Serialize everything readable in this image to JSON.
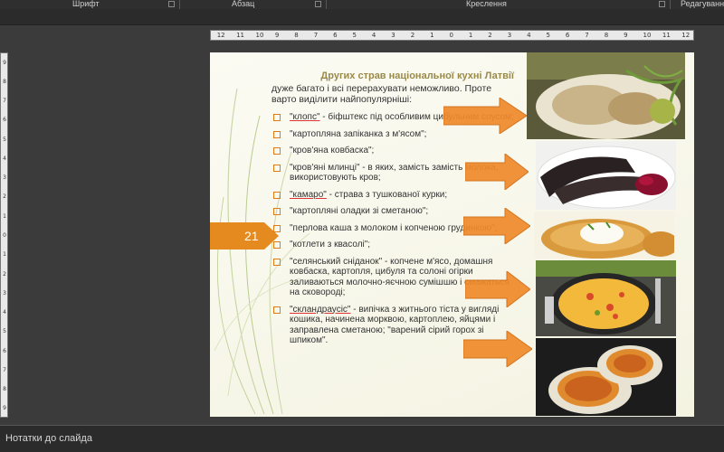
{
  "ribbon": {
    "groups": [
      "Шрифт",
      "Абзац",
      "Креслення",
      "Редагуванн"
    ]
  },
  "ruler": {
    "horizontal": [
      "12",
      "11",
      "10",
      "9",
      "8",
      "7",
      "6",
      "5",
      "4",
      "3",
      "2",
      "1",
      "0",
      "1",
      "2",
      "3",
      "4",
      "5",
      "6",
      "7",
      "8",
      "9",
      "10",
      "11",
      "12"
    ],
    "vertical": [
      "9",
      "8",
      "7",
      "6",
      "5",
      "4",
      "3",
      "2",
      "1",
      "0",
      "1",
      "2",
      "3",
      "4",
      "5",
      "6",
      "7",
      "8",
      "9"
    ]
  },
  "slide": {
    "title": "Других страв національної кухні Латвії",
    "intro": "дуже багато і всі перерахувати неможливо. Проте варто виділити найпопулярніші:",
    "page_number": "21",
    "items": [
      {
        "dish": "\"клопс\"",
        "rest": " - біфштекс під особливим цибульним соусом;"
      },
      {
        "dish": "",
        "rest": " \"картопляна запіканка з м'ясом\";"
      },
      {
        "dish": "",
        "rest": "\"кров'яна ковбаска\";"
      },
      {
        "dish": "",
        "rest": "\"кров'яні млинці\" - в яких, замість замість молока, використовують кров;"
      },
      {
        "dish": "\"камаро\"",
        "rest": " - страва з тушкованої курки;"
      },
      {
        "dish": "",
        "rest": "\"картопляні оладки зі сметаною\";"
      },
      {
        "dish": "",
        "rest": "\"перлова каша з молоком і копченою грудинкою\";"
      },
      {
        "dish": "",
        "rest": "\"котлети з квасолі\";"
      },
      {
        "dish": "",
        "rest": "\"селянський сніданок\" - копчене м'ясо, домашня ковбаска, картопля, цибуля та солоні огірки заливаються молочно-яєчною сумішшю і смажаться на сковороді;"
      },
      {
        "dish": "\"скландраусіс\"",
        "rest": " - випічка з житнього тіста у вигляді кошика, начинена морквою, картоплею, яйцями і заправлена сметаною; \"варений сірий горох зі шпиком\"."
      }
    ]
  },
  "notes": {
    "label": "Нотатки до слайда"
  },
  "colors": {
    "accent": "#e07b16",
    "title": "#9a8a4a",
    "background": "#3b3b3b"
  }
}
